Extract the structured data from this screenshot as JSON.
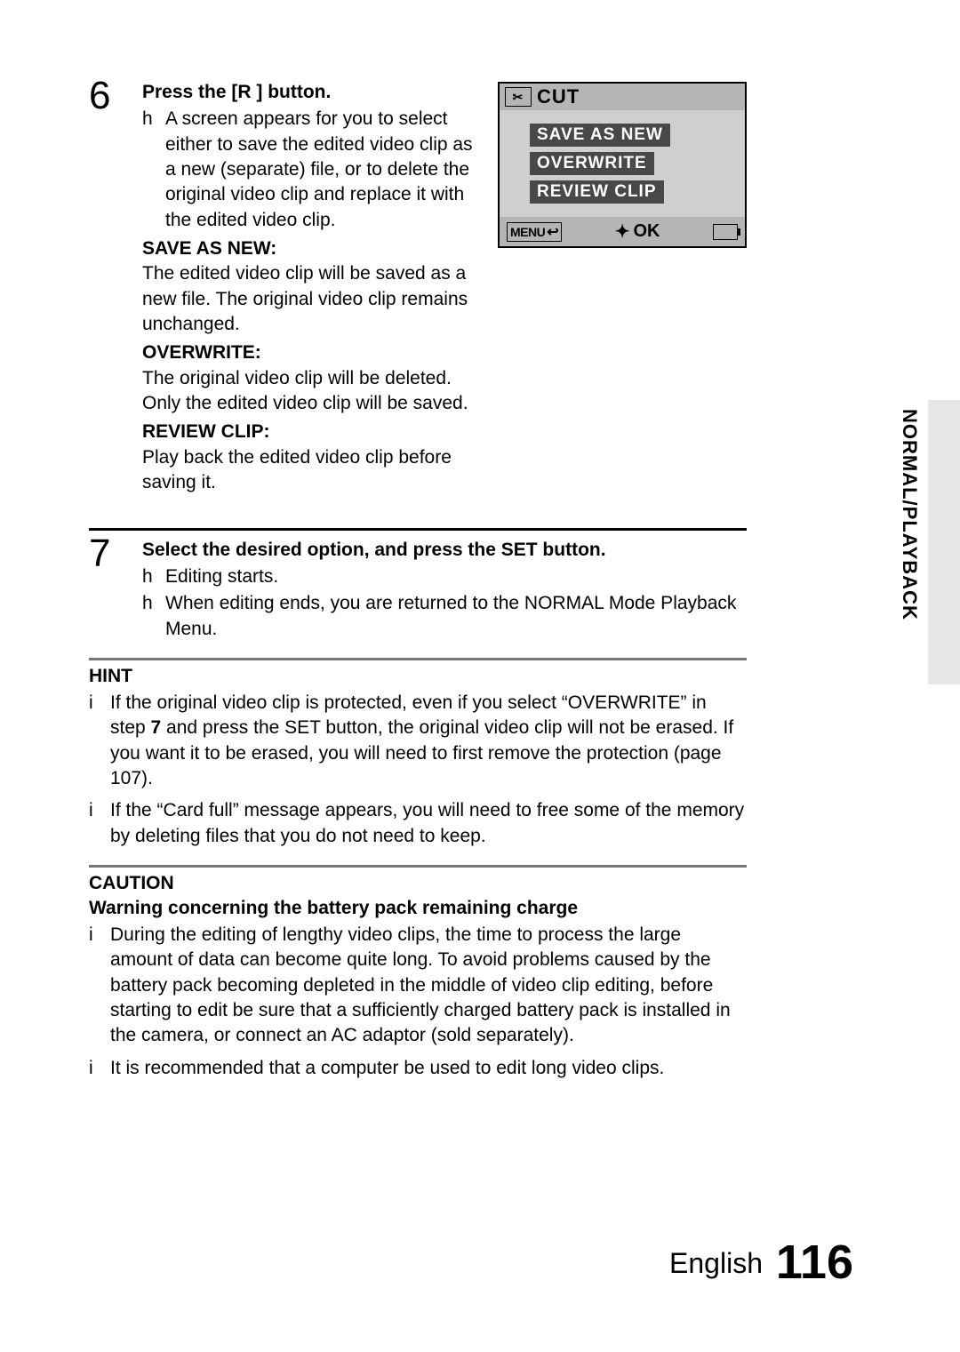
{
  "side_label": "NORMAL/PLAYBACK",
  "footer": {
    "lang": "English",
    "page": "116"
  },
  "lcd": {
    "title": "CUT",
    "options": [
      "SAVE AS NEW",
      "OVERWRITE",
      "REVIEW CLIP"
    ],
    "menu_label": "MENU",
    "ok_label": "OK"
  },
  "step6": {
    "num": "6",
    "title": "Press the [R   ] button.",
    "desc_bullet": "h",
    "desc": "A screen appears for you to select either to save the edited video clip as a new (separate) file, or to delete the original video clip and replace it with the edited video clip.",
    "defs": [
      {
        "term": "SAVE AS NEW:",
        "body": "The edited video clip will be saved as a new file. The original video clip remains unchanged."
      },
      {
        "term": "OVERWRITE:",
        "body": "The original video clip will be deleted. Only the edited video clip will be saved."
      },
      {
        "term": "REVIEW CLIP:",
        "body": "Play back the edited video clip before saving it."
      }
    ]
  },
  "step7": {
    "num": "7",
    "title": "Select the desired option, and press the SET button.",
    "bullets": [
      {
        "m": "h",
        "t": "Editing starts."
      },
      {
        "m": "h",
        "t": "When editing ends, you are returned to the NORMAL Mode Playback Menu."
      }
    ]
  },
  "hint": {
    "label": "HINT",
    "items": [
      {
        "m": "i",
        "t": "If the original video clip is protected, even if you select “OVERWRITE” in step 7 and press the SET button, the original video clip will not be erased. If you want it to be erased, you will need to first remove the protection (page 107).",
        "bold_step": "7"
      },
      {
        "m": "i",
        "t": "If the “Card full” message appears, you will need to free some of the memory by deleting files that you do not need to keep."
      }
    ]
  },
  "caution": {
    "label": "CAUTION",
    "sub": "Warning concerning the battery pack remaining charge",
    "items": [
      {
        "m": "i",
        "t": "During the editing of lengthy video clips, the time to process the large amount of data can become quite long. To avoid problems caused by the battery pack becoming depleted in the middle of video clip editing, before starting to edit be sure that a sufficiently charged battery pack is installed in the camera, or connect an AC adaptor (sold separately)."
      },
      {
        "m": "i",
        "t": "It is recommended that a computer be used to edit long video clips."
      }
    ]
  }
}
